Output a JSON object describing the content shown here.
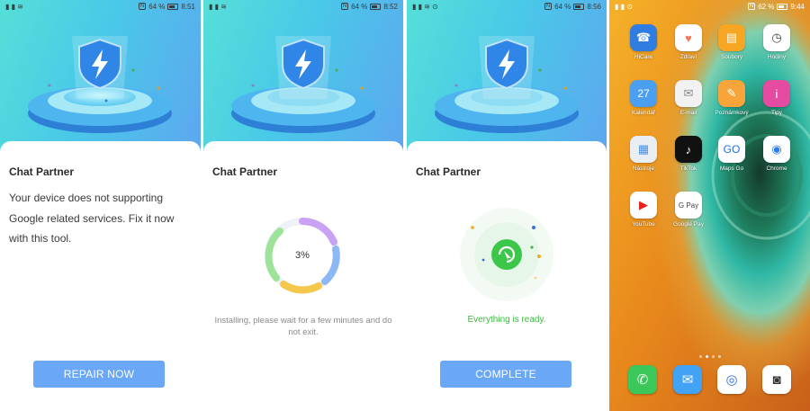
{
  "status_bars": [
    {
      "battery": "64 %",
      "time": "8:51"
    },
    {
      "battery": "64 %",
      "time": "8:52"
    },
    {
      "battery": "64 %",
      "time": "8:56"
    },
    {
      "battery": "62 %",
      "time": "9:44"
    }
  ],
  "screen1": {
    "app_title": "Chat Partner",
    "description": "Your device does not supporting Google related services. Fix it now with this tool.",
    "button_label": "REPAIR NOW"
  },
  "screen2": {
    "app_title": "Chat Partner",
    "progress_percent_label": "3%",
    "progress": 0.03,
    "note": "Installing, please wait for a few minutes and do not exit."
  },
  "screen3": {
    "app_title": "Chat Partner",
    "status": "Everything is ready.",
    "button_label": "COMPLETE"
  },
  "home": {
    "apps": [
      {
        "label": "HiCare",
        "icon": "hicare-icon",
        "color": "#2f7de0"
      },
      {
        "label": "Zdraví",
        "icon": "health-icon",
        "color": "#ffffff"
      },
      {
        "label": "Soubory",
        "icon": "files-icon",
        "color": "#f6a623"
      },
      {
        "label": "Hodiny",
        "icon": "clock-icon",
        "color": "#ffffff"
      },
      {
        "label": "Kalendář",
        "icon": "calendar-icon",
        "color": "#4a9ff0",
        "text": "27"
      },
      {
        "label": "E-mail",
        "icon": "email-icon",
        "color": "#f2f2f2"
      },
      {
        "label": "Poznámkový",
        "icon": "notepad-icon",
        "color": "#f7a53a"
      },
      {
        "label": "Tipy",
        "icon": "tips-icon",
        "color": "#e64ba2"
      },
      {
        "label": "Nástroje",
        "icon": "tools-folder-icon",
        "color": "#e9eef5"
      },
      {
        "label": "TikTok",
        "icon": "tiktok-icon",
        "color": "#111111"
      },
      {
        "label": "Maps Go",
        "icon": "maps-go-icon",
        "color": "#ffffff",
        "text": "GO"
      },
      {
        "label": "Chrome",
        "icon": "chrome-icon",
        "color": "#ffffff"
      },
      {
        "label": "YouTube",
        "icon": "youtube-icon",
        "color": "#ffffff"
      },
      {
        "label": "Google Pay",
        "icon": "google-pay-icon",
        "color": "#ffffff",
        "text": "G Pay"
      }
    ],
    "dock": [
      {
        "icon": "phone-icon",
        "color": "#3cc75a"
      },
      {
        "icon": "messages-icon",
        "color": "#42a2f5"
      },
      {
        "icon": "browser-icon",
        "color": "#ffffff"
      },
      {
        "icon": "camera-icon",
        "color": "#ffffff"
      }
    ]
  },
  "colors": {
    "button": "#6aa8f7",
    "ready_green": "#3cb93f",
    "hero_gradient": [
      "#56dfd8",
      "#5ea6ef"
    ]
  }
}
